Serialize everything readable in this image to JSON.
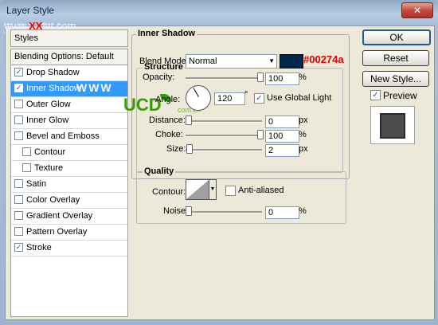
{
  "window": {
    "title": "Layer Style",
    "watermark_cn": "思缘教程论坛",
    "watermark_url_prefix": "www.",
    "watermark_xx": "XX",
    "watermark_url_suffix": "tvt.com",
    "close_label": "✕"
  },
  "styles": {
    "header": "Styles",
    "items": [
      {
        "label": "Blending Options: Default",
        "checkbox": false,
        "checked": false,
        "selected": false,
        "indent": false
      },
      {
        "label": "Drop Shadow",
        "checkbox": true,
        "checked": true,
        "selected": false,
        "indent": false
      },
      {
        "label": "Inner Shadow",
        "checkbox": true,
        "checked": true,
        "selected": true,
        "indent": false
      },
      {
        "label": "Outer Glow",
        "checkbox": true,
        "checked": false,
        "selected": false,
        "indent": false
      },
      {
        "label": "Inner Glow",
        "checkbox": true,
        "checked": false,
        "selected": false,
        "indent": false
      },
      {
        "label": "Bevel and Emboss",
        "checkbox": true,
        "checked": false,
        "selected": false,
        "indent": false
      },
      {
        "label": "Contour",
        "checkbox": true,
        "checked": false,
        "selected": false,
        "indent": true
      },
      {
        "label": "Texture",
        "checkbox": true,
        "checked": false,
        "selected": false,
        "indent": true
      },
      {
        "label": "Satin",
        "checkbox": true,
        "checked": false,
        "selected": false,
        "indent": false
      },
      {
        "label": "Color Overlay",
        "checkbox": true,
        "checked": false,
        "selected": false,
        "indent": false
      },
      {
        "label": "Gradient Overlay",
        "checkbox": true,
        "checked": false,
        "selected": false,
        "indent": false
      },
      {
        "label": "Pattern Overlay",
        "checkbox": true,
        "checked": false,
        "selected": false,
        "indent": false
      },
      {
        "label": "Stroke",
        "checkbox": true,
        "checked": true,
        "selected": false,
        "indent": false
      }
    ],
    "selected_watermark": "WWW"
  },
  "inner_shadow": {
    "section_title": "Inner Shadow",
    "structure_title": "Structure",
    "blend_mode_label": "Blend Mode:",
    "blend_mode_value": "Normal",
    "color_hex": "#00274a",
    "color_label": "#00274a",
    "opacity_label": "Opacity:",
    "opacity_value": "100",
    "angle_label": "Angle:",
    "angle_value": "120",
    "angle_unit": "°",
    "use_global_light_label": "Use Global Light",
    "use_global_light": true,
    "distance_label": "Distance:",
    "distance_value": "0",
    "choke_label": "Choke:",
    "choke_value": "100",
    "size_label": "Size:",
    "size_value": "2",
    "unit_px": "px",
    "unit_pct": "%"
  },
  "quality": {
    "title": "Quality",
    "contour_label": "Contour:",
    "anti_aliased_label": "Anti-aliased",
    "anti_aliased": false,
    "noise_label": "Noise:",
    "noise_value": "0",
    "unit_pct": "%"
  },
  "buttons": {
    "ok": "OK",
    "reset": "Reset",
    "new_style": "New Style...",
    "preview_label": "Preview",
    "preview_checked": true
  },
  "logo": {
    "text": "UCD",
    "sub": "com.cn"
  }
}
